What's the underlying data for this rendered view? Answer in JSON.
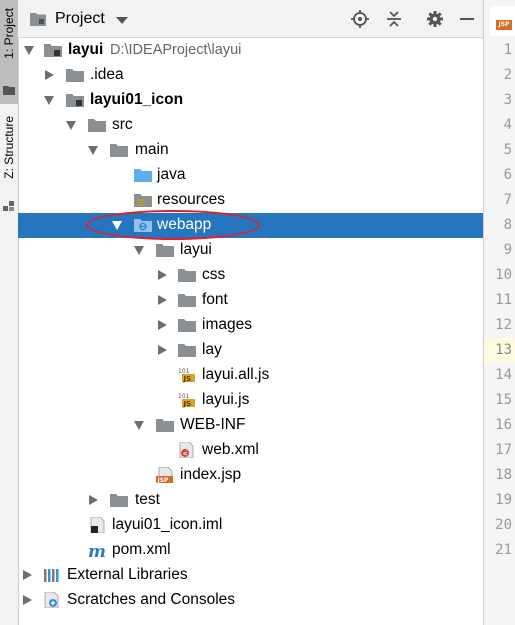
{
  "side_strip": {
    "project_tab": "1: Project",
    "structure_tab": "Z: Structure"
  },
  "header": {
    "title": "Project",
    "dropdown_icon": "chevron-down-icon",
    "buttons": [
      "target-icon",
      "collapse-icon",
      "gear-icon",
      "minimize-icon"
    ]
  },
  "tree": {
    "root": {
      "label": "layui",
      "path": "D:\\IDEAProject\\layui"
    },
    "idea": {
      "label": ".idea"
    },
    "module": {
      "label": "layui01_icon"
    },
    "src": {
      "label": "src"
    },
    "main": {
      "label": "main"
    },
    "java": {
      "label": "java"
    },
    "resources": {
      "label": "resources"
    },
    "webapp": {
      "label": "webapp"
    },
    "layui_dir": {
      "label": "layui"
    },
    "css": {
      "label": "css"
    },
    "font": {
      "label": "font"
    },
    "images": {
      "label": "images"
    },
    "lay": {
      "label": "lay"
    },
    "layui_all_js": {
      "label": "layui.all.js"
    },
    "layui_js": {
      "label": "layui.js"
    },
    "webinf": {
      "label": "WEB-INF"
    },
    "webxml": {
      "label": "web.xml"
    },
    "indexjsp": {
      "label": "index.jsp"
    },
    "test": {
      "label": "test"
    },
    "iml": {
      "label": "layui01_icon.iml"
    },
    "pom": {
      "label": "pom.xml"
    },
    "ext_libs": {
      "label": "External Libraries"
    },
    "scratches": {
      "label": "Scratches and Consoles"
    }
  },
  "selected_item": "webapp",
  "annotation_color": "#e0202a",
  "selection_color": "#2675bf",
  "editor": {
    "tab_badge": "JSP",
    "current_line": 13,
    "line_numbers": [
      "1",
      "2",
      "3",
      "4",
      "5",
      "6",
      "7",
      "8",
      "9",
      "10",
      "11",
      "12",
      "13",
      "14",
      "15",
      "16",
      "17",
      "18",
      "19",
      "20",
      "21"
    ]
  }
}
